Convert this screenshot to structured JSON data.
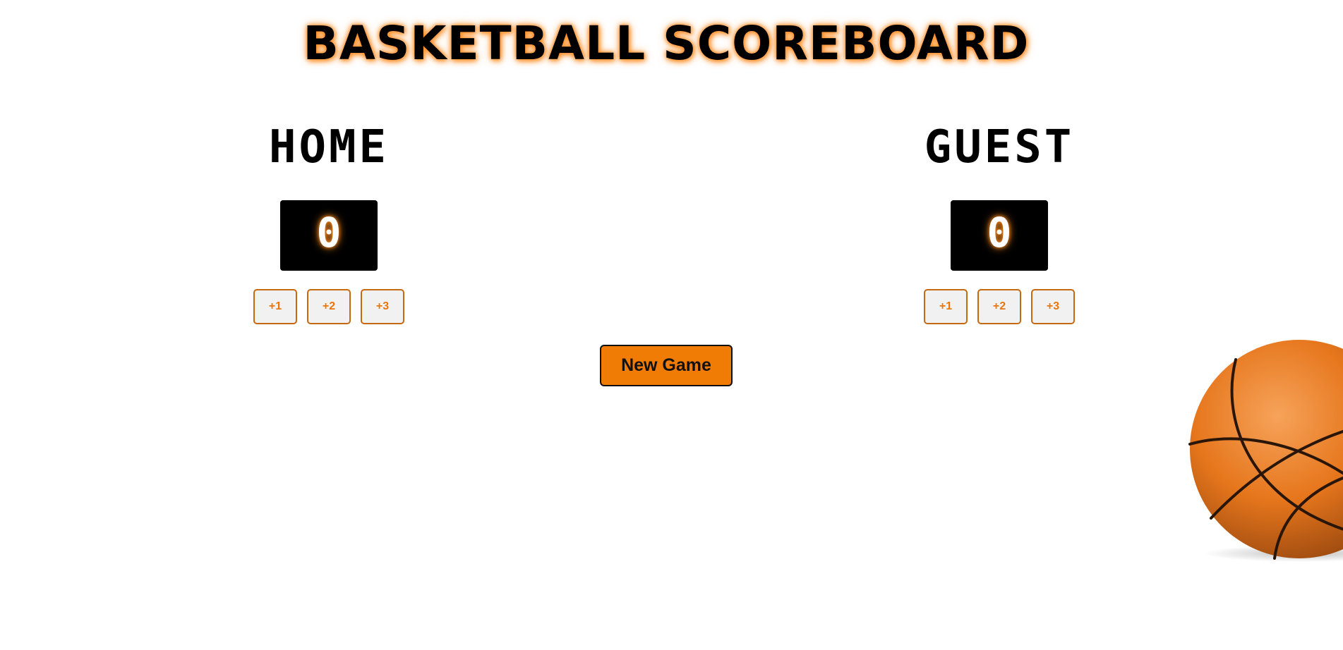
{
  "header": {
    "title": "BASKETBALL SCOREBOARD"
  },
  "home": {
    "name": "HOME",
    "score": "0",
    "buttons": [
      "+1",
      "+2",
      "+3"
    ]
  },
  "guest": {
    "name": "GUEST",
    "score": "0",
    "buttons": [
      "+1",
      "+2",
      "+3"
    ]
  },
  "controls": {
    "new_game_label": "New Game"
  },
  "decor": {
    "ball_icon": "basketball-icon"
  },
  "colors": {
    "accent": "#f07b05",
    "score_bg": "#000000",
    "button_text": "#e8760c",
    "button_border": "#c56a12"
  }
}
